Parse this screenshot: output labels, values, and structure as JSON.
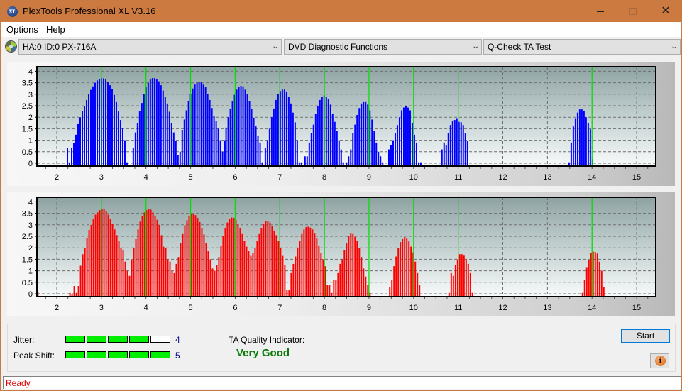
{
  "window": {
    "title": "PlexTools Professional XL V3.16",
    "app_icon": "xl-logo-icon",
    "controls": [
      "minimize-icon",
      "maximize-icon",
      "close-icon"
    ]
  },
  "menu": {
    "items": [
      {
        "label": "Options"
      },
      {
        "label": "Help"
      }
    ]
  },
  "toolbar": {
    "drive_icon": "disc-icon",
    "drive_select": "HA:0 ID:0  PX-716A",
    "function_select": "DVD Diagnostic Functions",
    "test_select": "Q-Check TA Test"
  },
  "colors": {
    "top_bars": "#0000ff",
    "bottom_bars": "#ff0000",
    "marker_lines": "#00e000",
    "quality_text": "#0a7a0a",
    "status_text": "#e00000",
    "title_bar": "#cc7a40"
  },
  "chart_data": [
    {
      "type": "bar",
      "name": "ta-lands-chart",
      "xlabel": "",
      "ylabel": "",
      "xlim": [
        1.55,
        15.43
      ],
      "ylim": [
        -0.15,
        4.2
      ],
      "xticks": [
        "2",
        "3",
        "4",
        "5",
        "6",
        "7",
        "8",
        "9",
        "10",
        "11",
        "12",
        "13",
        "14",
        "15"
      ],
      "yticks": [
        "0",
        "0.5",
        "1",
        "1.5",
        "2",
        "2.5",
        "3",
        "3.5",
        "4"
      ],
      "grid": true,
      "markers_x": [
        3,
        4,
        5,
        6,
        7,
        8,
        9,
        10,
        11,
        14
      ],
      "bar_step": 0.0477,
      "series_color": "#0000ff",
      "clusters": [
        {
          "start": 2.223,
          "values": [
            0.66,
            0.04,
            0.66,
            0.87,
            1.24,
            1.7,
            2.0,
            2.26,
            2.5,
            2.75,
            3.0,
            3.19,
            3.34,
            3.5,
            3.6,
            3.67,
            3.7,
            3.69,
            3.64,
            3.54,
            3.39,
            3.22,
            2.97,
            2.66,
            2.25,
            1.88,
            1.51,
            1.0,
            0.04
          ]
        },
        {
          "start": 3.7,
          "values": [
            0.66,
            1.34,
            1.75,
            2.26,
            2.62,
            3.0,
            3.3,
            3.5,
            3.64,
            3.7,
            3.7,
            3.64,
            3.56,
            3.39,
            3.16,
            2.88,
            2.6,
            2.24,
            1.75,
            1.34,
            0.96,
            0.34,
            0.5,
            1.45,
            1.9
          ]
        },
        {
          "start": 4.89,
          "values": [
            2.3,
            2.7,
            3.0,
            3.25,
            3.42,
            3.5,
            3.55,
            3.53,
            3.42,
            3.3,
            3.02,
            2.75,
            2.4,
            2.05,
            1.82,
            1.5,
            1.0,
            0.5,
            1.0
          ]
        },
        {
          "start": 5.78,
          "values": [
            1.55,
            2.0,
            2.38,
            2.7,
            2.98,
            3.2,
            3.32,
            3.36,
            3.34,
            3.2,
            3.02,
            2.7,
            2.38,
            1.98,
            1.6,
            1.2,
            0.9,
            0.04
          ]
        },
        {
          "start": 6.66,
          "values": [
            0.66,
            1.0,
            1.5,
            2.0,
            2.38,
            2.75,
            3.0,
            3.14,
            3.2,
            3.2,
            3.12,
            2.9,
            2.6,
            2.2,
            1.78,
            1.0,
            0.04,
            0.04
          ]
        },
        {
          "start": 7.55,
          "values": [
            0.3,
            0.3,
            0.9,
            1.3,
            1.68,
            2.15,
            2.5,
            2.75,
            2.88,
            2.95,
            2.9,
            2.8,
            2.55,
            2.16,
            1.8,
            1.4,
            1.0,
            0.6,
            0.04
          ]
        },
        {
          "start": 8.48,
          "values": [
            0.04,
            0.3,
            0.6,
            1.3,
            1.68,
            2.1,
            2.4,
            2.6,
            2.66,
            2.66,
            2.55,
            2.3,
            1.9,
            1.4,
            0.9,
            0.5,
            0.3,
            0.04
          ]
        },
        {
          "start": 9.43,
          "values": [
            0.6,
            0.8,
            1.0,
            1.3,
            1.66,
            2.0,
            2.3,
            2.42,
            2.48,
            2.42,
            2.3,
            1.74,
            1.24,
            0.9,
            0.04,
            0.04
          ]
        },
        {
          "start": 10.62,
          "values": [
            0.6,
            0.9,
            0.8,
            1.3,
            1.66,
            1.84,
            1.88,
            1.96,
            1.8,
            1.78,
            1.66,
            1.3,
            0.96
          ]
        },
        {
          "start": 13.47,
          "values": [
            0.04,
            0.9,
            1.6,
            1.96,
            2.2,
            2.34,
            2.34,
            2.28,
            2.0,
            1.76,
            1.48,
            0.18
          ]
        }
      ]
    },
    {
      "type": "bar",
      "name": "ta-pits-chart",
      "xlabel": "",
      "ylabel": "",
      "xlim": [
        1.55,
        15.43
      ],
      "ylim": [
        -0.15,
        4.2
      ],
      "xticks": [
        "2",
        "3",
        "4",
        "5",
        "6",
        "7",
        "8",
        "9",
        "10",
        "11",
        "12",
        "13",
        "14",
        "15"
      ],
      "yticks": [
        "0",
        "0.5",
        "1",
        "1.5",
        "2",
        "2.5",
        "3",
        "3.5",
        "4"
      ],
      "grid": true,
      "markers_x": [
        3,
        4,
        5,
        6,
        7,
        8,
        9,
        10,
        11,
        14
      ],
      "bar_step": 0.0477,
      "series_color": "#ff0000",
      "clusters": [
        {
          "start": 1.56,
          "values": [
            0.1
          ]
        },
        {
          "start": 2.28,
          "values": [
            0.04,
            0.0,
            0.34,
            0.04,
            0.34,
            1.22,
            1.72,
            1.98,
            2.44,
            2.78,
            3.0,
            3.26,
            3.44,
            3.54,
            3.64,
            3.7,
            3.68,
            3.58,
            3.44,
            3.26,
            3.05,
            2.8,
            2.55,
            2.28,
            1.98,
            1.88,
            1.4,
            1.0,
            0.78,
            1.48,
            1.98,
            2.38,
            2.8,
            3.14,
            3.38,
            3.54,
            3.64,
            3.7,
            3.66,
            3.54,
            3.4,
            3.22,
            3.0,
            2.55,
            2.05,
            1.98,
            1.5,
            1.4,
            1.0,
            0.9,
            1.3,
            1.6,
            2.2,
            2.6,
            2.98,
            3.2,
            3.38,
            3.48,
            3.48,
            3.42,
            3.3,
            3.12,
            2.86,
            2.58,
            2.2,
            1.85,
            1.5,
            1.1,
            1.0,
            1.25,
            1.6,
            2.1,
            2.5,
            2.85,
            3.1,
            3.25,
            3.32,
            3.3,
            3.22,
            3.05,
            2.85,
            2.6,
            2.3,
            2.05,
            1.85,
            1.65,
            1.78,
            2.0,
            2.3,
            2.6,
            2.85,
            3.05,
            3.15,
            3.15,
            3.1,
            2.95,
            2.75,
            2.55,
            2.3,
            2.0,
            1.65,
            1.25,
            0.18,
            0.18,
            0.9,
            1.3,
            1.62,
            2.0,
            2.3,
            2.6,
            2.8,
            2.9,
            2.92,
            2.88,
            2.8,
            2.62,
            2.4,
            2.1,
            1.78,
            1.5,
            1.2,
            0.4,
            0.4,
            0.04,
            0.6,
            0.6,
            0.9,
            1.3,
            1.5,
            1.9,
            2.2,
            2.5,
            2.62,
            2.6,
            2.48,
            2.3,
            2.0,
            1.6,
            1.1,
            0.75,
            0.4,
            0.04
          ]
        },
        {
          "start": 9.45,
          "values": [
            0.3,
            0.6,
            1.2,
            1.62,
            2.0,
            2.25,
            2.38,
            2.48,
            2.4,
            2.28,
            2.05,
            1.8,
            1.4,
            0.9,
            0.4
          ]
        },
        {
          "start": 10.78,
          "values": [
            0.04,
            0.9,
            0.78,
            1.26,
            1.5,
            1.72,
            1.72,
            1.66,
            1.5,
            1.3,
            0.9,
            0.04
          ]
        },
        {
          "start": 13.77,
          "values": [
            0.04,
            0.6,
            1.16,
            1.46,
            1.76,
            1.84,
            1.82,
            1.75,
            1.4,
            1.0,
            0.3
          ]
        }
      ]
    }
  ],
  "results": {
    "jitter_label": "Jitter:",
    "jitter_value": "4",
    "jitter_score": 4,
    "peak_shift_label": "Peak Shift:",
    "peak_shift_value": "5",
    "peak_shift_score": 5,
    "max_score": 5,
    "ta_quality_label": "TA Quality Indicator:",
    "ta_quality_value": "Very Good"
  },
  "buttons": {
    "start": "Start",
    "info_icon": "info-icon"
  },
  "status": {
    "text": "Ready"
  }
}
